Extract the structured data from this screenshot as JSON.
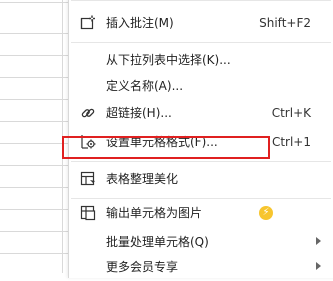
{
  "menu": {
    "items": [
      {
        "label": "插入批注(M)",
        "shortcut": "Shift+F2",
        "icon": "insert-comment-icon"
      },
      {
        "label": "从下拉列表中选择(K)...",
        "shortcut": "",
        "icon": ""
      },
      {
        "label": "定义名称(A)...",
        "shortcut": "",
        "icon": ""
      },
      {
        "label": "超链接(H)...",
        "shortcut": "Ctrl+K",
        "icon": "hyperlink-icon"
      },
      {
        "label": "设置单元格格式(F)...",
        "shortcut": "Ctrl+1",
        "icon": "format-cells-icon"
      },
      {
        "label": "表格整理美化",
        "shortcut": "",
        "icon": "table-beautify-icon"
      },
      {
        "label": "输出单元格为图片",
        "shortcut": "",
        "icon": "export-image-icon",
        "badge": "⚡"
      },
      {
        "label": "批量处理单元格(Q)",
        "shortcut": "",
        "icon": "",
        "has_submenu": true
      },
      {
        "label": "更多会员专享",
        "shortcut": "",
        "icon": "",
        "has_submenu": true
      }
    ]
  },
  "colors": {
    "highlight_border": "#e02020",
    "badge": "#f7c52e"
  }
}
